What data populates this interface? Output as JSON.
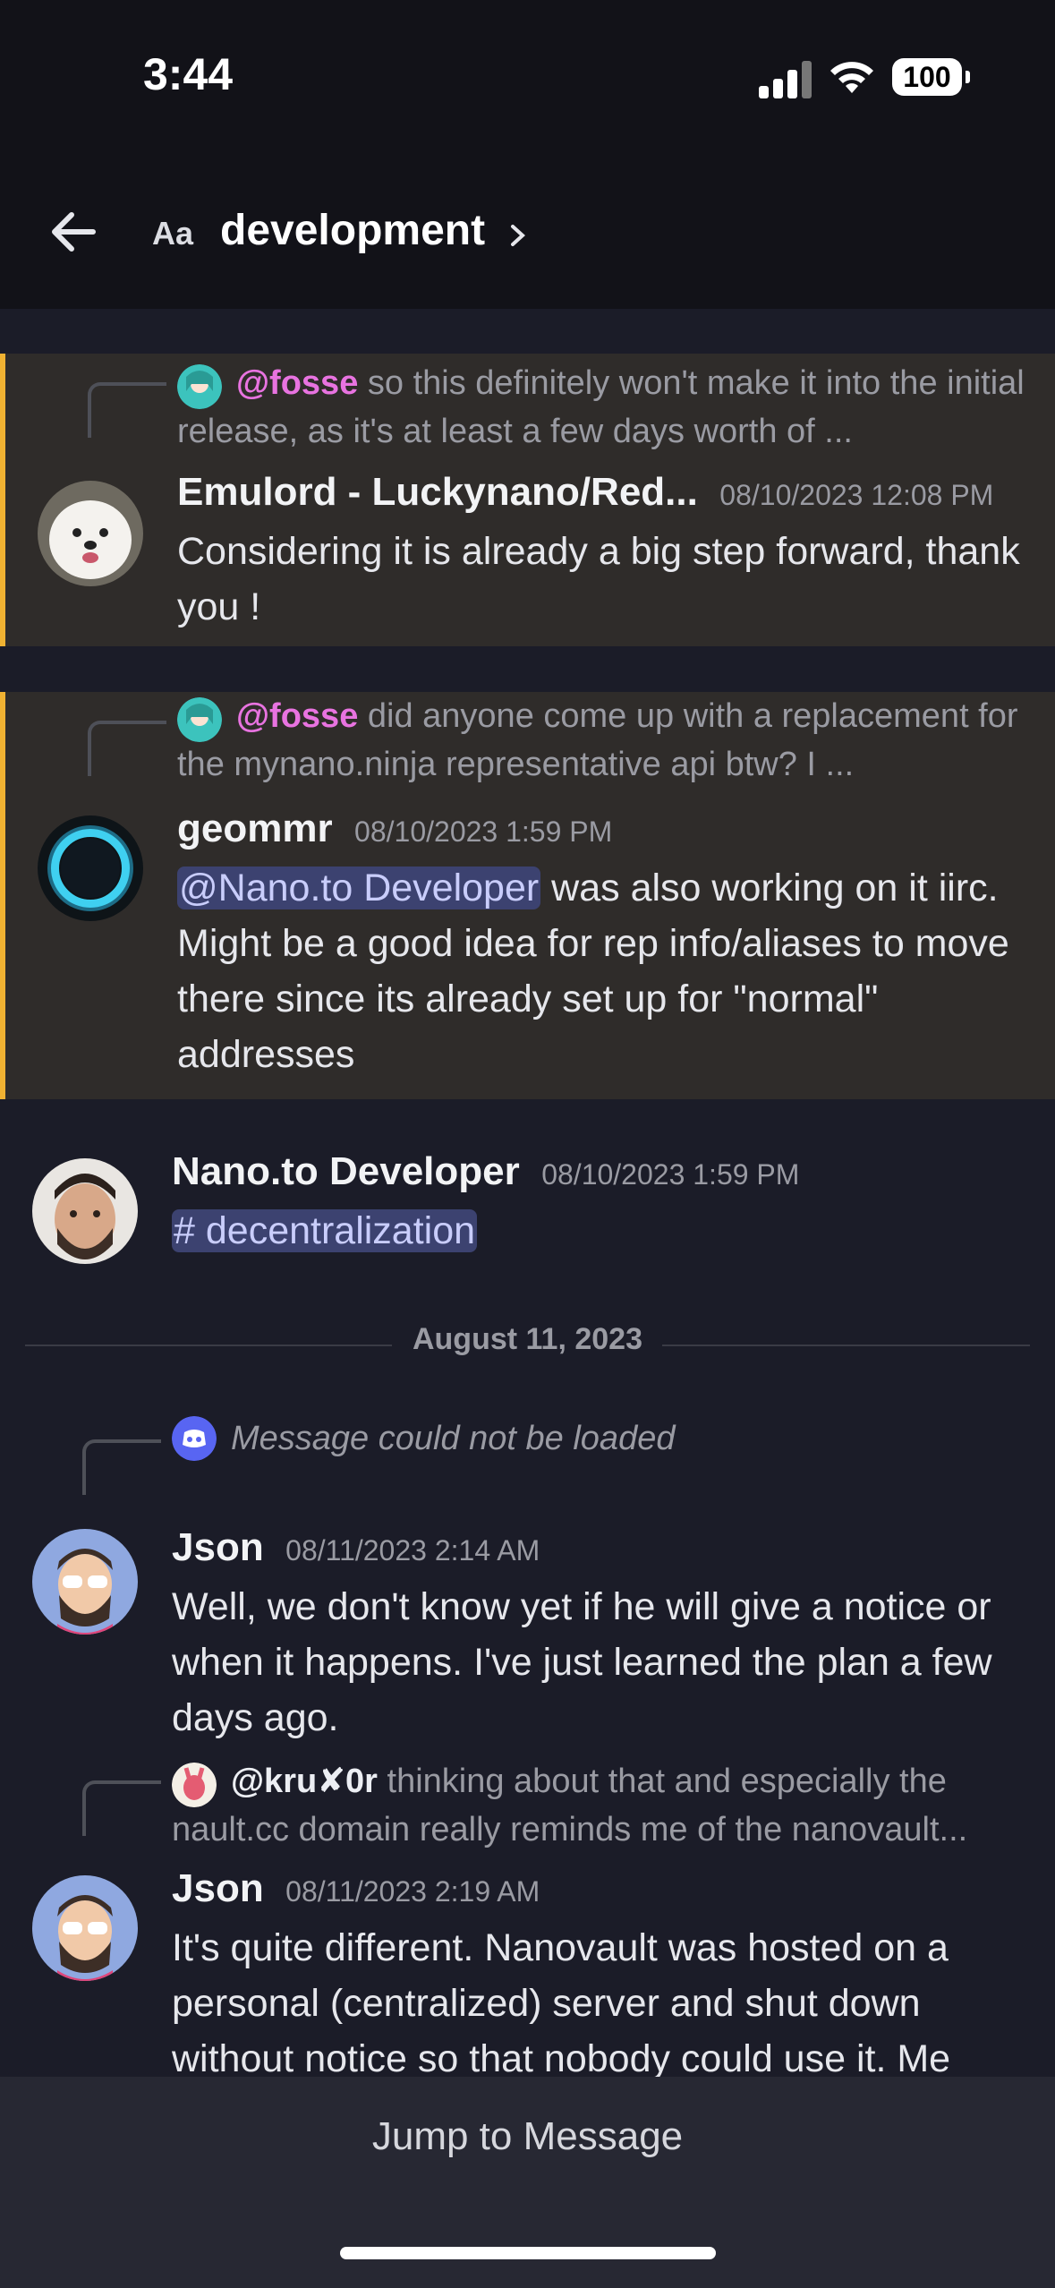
{
  "status_bar": {
    "time": "3:44",
    "battery": "100"
  },
  "header": {
    "aa_label": "Aa",
    "channel_name": "development"
  },
  "messages": [
    {
      "reply": {
        "name": "@fosse",
        "text": "so this definitely won't make it into the initial release, as it's at least a few days worth of ..."
      },
      "author": "Emulord - Luckynano/Red...",
      "timestamp": "08/10/2023 12:08 PM",
      "body": "Considering it is already a big step forward, thank you !"
    },
    {
      "reply": {
        "name": "@fosse",
        "text": "did anyone come up with a replacement for the mynano.ninja representative api btw? I ..."
      },
      "author": "geommr",
      "timestamp": "08/10/2023 1:59 PM",
      "mention": "@Nano.to Developer",
      "body": "was also working on it iirc. Might be a good idea for rep info/aliases to move there since its already set up for \"normal\" addresses"
    },
    {
      "author": "Nano.to Developer",
      "timestamp": "08/10/2023 1:59 PM",
      "channel_mention": "# decentralization"
    },
    {
      "reply": {
        "text": "Message could not be loaded"
      },
      "author": "Json",
      "timestamp": "08/11/2023 2:14 AM",
      "body": "Well, we don't know yet if he will give a notice or when it happens. I've just learned the plan a few days ago."
    },
    {
      "reply": {
        "name": "@kru✘0r",
        "text": "thinking about that and especially the nault.cc domain really reminds me of the nanovault..."
      },
      "author": "Json",
      "timestamp": "08/11/2023 2:19 AM",
      "body": "It's quite different. Nanovault was hosted on a personal (centralized) server and shut down without notice so that nobody could use it. Me"
    }
  ],
  "date_divider": "August 11, 2023",
  "jump_button": "Jump to Message",
  "colors": {
    "highlight_border": "#f0b232",
    "mention_bg": "#3c4270",
    "reply_name": "#e873e0"
  }
}
